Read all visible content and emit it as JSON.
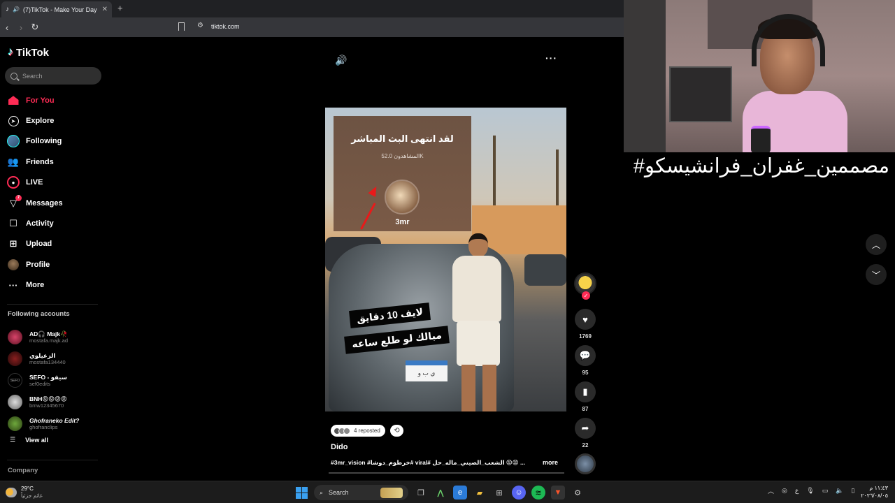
{
  "browser": {
    "tab_title": "(7)TikTok - Make Your Day",
    "url": "tiktok.com"
  },
  "sidebar": {
    "brand": "TikTok",
    "search_placeholder": "Search",
    "nav": [
      {
        "label": "For You",
        "icon": "home-icon",
        "active": true
      },
      {
        "label": "Explore",
        "icon": "compass-icon"
      },
      {
        "label": "Following",
        "icon": "following-avatar-icon"
      },
      {
        "label": "Friends",
        "icon": "friends-icon"
      },
      {
        "label": "LIVE",
        "icon": "live-icon"
      },
      {
        "label": "Messages",
        "icon": "messages-icon",
        "badge": "7"
      },
      {
        "label": "Activity",
        "icon": "activity-icon"
      },
      {
        "label": "Upload",
        "icon": "upload-icon"
      },
      {
        "label": "Profile",
        "icon": "profile-icon"
      },
      {
        "label": "More",
        "icon": "more-icon"
      }
    ],
    "following_title": "Following accounts",
    "following": [
      {
        "name": "AD🎧 Majk🥀",
        "user": "mostafa.majk.ad"
      },
      {
        "name": "الزعيلوي",
        "user": "mostafa134440"
      },
      {
        "name": "SEFO - سيفو",
        "user": "sef0edits"
      },
      {
        "name": "BNH😡😡😡😡",
        "user": "bmw12345670"
      },
      {
        "name": "Ghofraneko Edit?",
        "user": "ghofranclips"
      }
    ],
    "view_all": "View all",
    "company": "Company"
  },
  "video": {
    "live_ended_title": "لقد انتهى البث المباشر",
    "viewers_text": "المشاهدون 52.0K",
    "host_name": "3mr",
    "caption_line1": "لايف 10 دقايق",
    "caption_line2": "مبالك لو طلع ساعه",
    "plate_text": "ي ب و"
  },
  "actions": {
    "likes": "1769",
    "comments": "95",
    "saves": "87",
    "shares": "22"
  },
  "post": {
    "reposted": "4 reposted",
    "author": "Dido",
    "description": "#3mr_vision #خرطوم_دوشا# viral# الشعب_الصيني_ماله_حل 😡😡 ...",
    "more": "more",
    "progress": 0.0
  },
  "overlay": {
    "hashtag": "#مصممين_غفران_فرانشيسكو"
  },
  "taskbar": {
    "temperature": "29°C",
    "weather_condition": "غائم جزئياً",
    "search_label": "Search",
    "language": "ع",
    "time": "١١:٤٣ م",
    "date": "٢٠٢٦/٠٨/٠٥"
  },
  "colors": {
    "accent": "#fe2c55",
    "background": "#000000"
  }
}
